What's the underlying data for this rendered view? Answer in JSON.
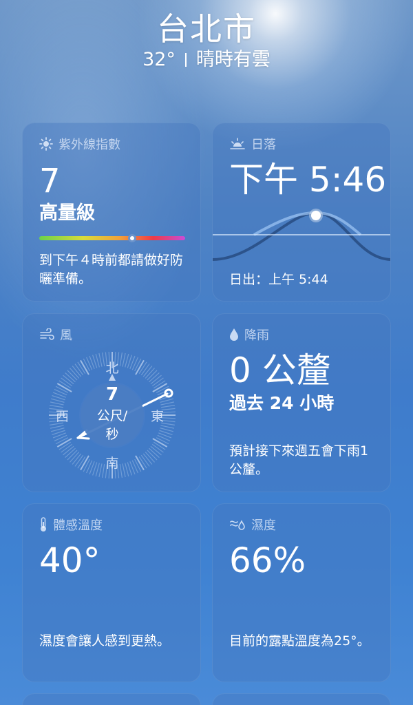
{
  "header": {
    "city": "台北市",
    "temperature": "32°",
    "condition": "晴時有雲"
  },
  "uv": {
    "title": "紫外線指數",
    "icon": "sun-icon",
    "value": "7",
    "level": "高量級",
    "scale_max": 11,
    "description": "到下午４時前都請做好防曬準備。"
  },
  "sunset": {
    "title": "日落",
    "icon": "sunset-icon",
    "time": "下午 5:46",
    "sunrise": "日出：上午 5:44"
  },
  "wind": {
    "title": "風",
    "icon": "wind-icon",
    "speed": "7",
    "unit_line1": "公尺/",
    "unit_line2": "秒",
    "north": "北",
    "south": "南",
    "east": "東",
    "west": "西"
  },
  "rain": {
    "title": "降雨",
    "icon": "raindrop-icon",
    "amount": "0 公釐",
    "period": "過去 24 小時",
    "description": "預計接下來週五會下雨1公釐。"
  },
  "feels_like": {
    "title": "體感溫度",
    "icon": "thermometer-icon",
    "value": "40°",
    "description": "濕度會讓人感到更熱。"
  },
  "humidity": {
    "title": "濕度",
    "icon": "humidity-icon",
    "value": "66%",
    "description": "目前的露點溫度為25°。"
  }
}
